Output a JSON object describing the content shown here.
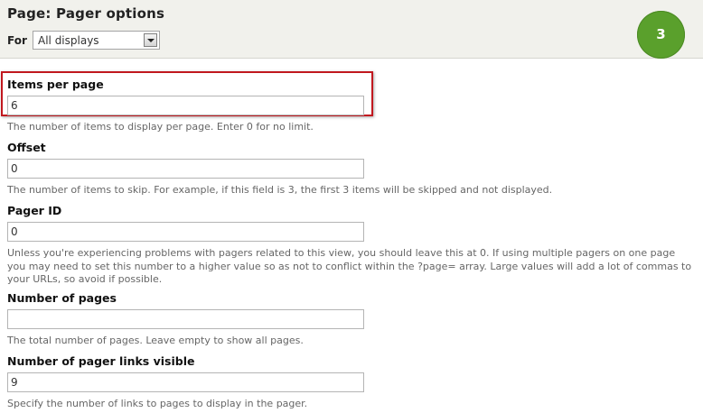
{
  "header": {
    "title": "Page: Pager options",
    "for_label": "For",
    "display_select": {
      "value": "All displays"
    },
    "step_badge": "3"
  },
  "fields": {
    "items_per_page": {
      "label": "Items per page",
      "value": "6",
      "description": "The number of items to display per page. Enter 0 for no limit."
    },
    "offset": {
      "label": "Offset",
      "value": "0",
      "description": "The number of items to skip. For example, if this field is 3, the first 3 items will be skipped and not displayed."
    },
    "pager_id": {
      "label": "Pager ID",
      "value": "0",
      "description": "Unless you're experiencing problems with pagers related to this view, you should leave this at 0. If using multiple pagers on one page you may need to set this number to a higher value so as not to conflict within the ?page= array. Large values will add a lot of commas to your URLs, so avoid if possible."
    },
    "number_of_pages": {
      "label": "Number of pages",
      "value": "",
      "description": "The total number of pages. Leave empty to show all pages."
    },
    "pager_links_visible": {
      "label": "Number of pager links visible",
      "value": "9",
      "description": "Specify the number of links to pages to display in the pager."
    }
  },
  "colors": {
    "highlight": "#c1181f",
    "badge": "#5aa02c",
    "header_bg": "#f1f1ec"
  }
}
